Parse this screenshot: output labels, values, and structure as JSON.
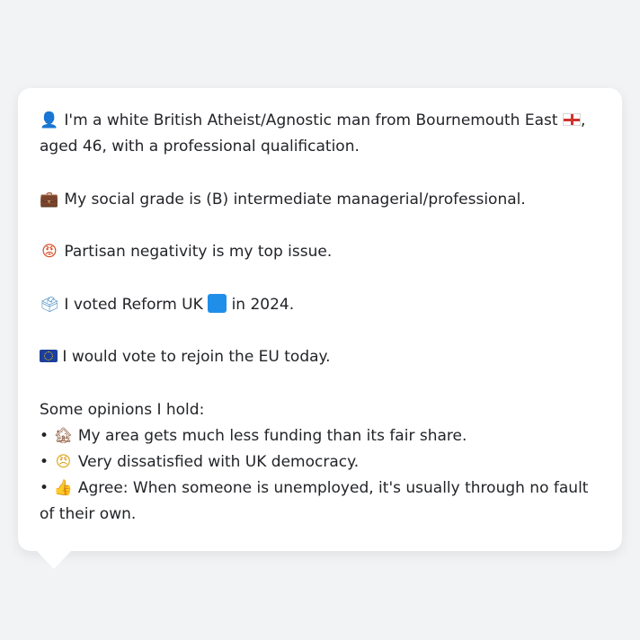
{
  "persona": {
    "intro_pre": "I'm a white British Atheist/Agnostic man from Bournemouth East",
    "intro_post": ", aged 46, with a professional qualification.",
    "grade": "My social grade is (B) intermediate managerial/professional.",
    "issue": "Partisan negativity is my top issue.",
    "vote_pre": "I voted Reform UK",
    "vote_post": "in 2024.",
    "eu": "I would vote to rejoin the EU today.",
    "opinions_header": "Some opinions I hold:",
    "opinions": [
      {
        "bullet": "•",
        "text": "My area gets much less funding than its fair share."
      },
      {
        "bullet": "•",
        "text": "Very dissatisfied with UK democracy."
      },
      {
        "bullet": "•",
        "text": "Agree: When someone is unemployed, it's usually through no fault of their own."
      }
    ]
  },
  "icons": {
    "person": "person-silhouette-icon",
    "england_flag": "england-flag-icon",
    "briefcase": "briefcase-icon",
    "angry_face": "angry-face-icon",
    "ballot_box": "ballot-box-icon",
    "party_color_square": "blue-square-icon",
    "eu_flag": "eu-flag-icon",
    "house": "derelict-house-icon",
    "pouting_face": "pouting-face-icon",
    "thumbs_up": "thumbs-up-icon"
  },
  "colors": {
    "background": "#f2f3f5",
    "card": "#ffffff",
    "text": "#222428",
    "reform_blue": "#1f8ee9"
  }
}
